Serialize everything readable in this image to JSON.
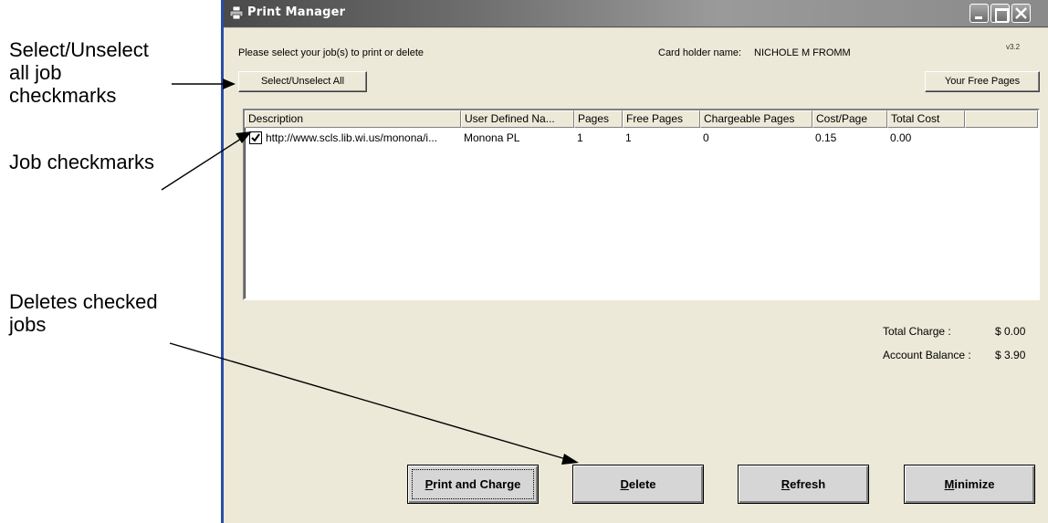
{
  "annotations": {
    "select_all_note": [
      "Select/Unselect",
      "all job",
      "checkmarks"
    ],
    "job_checkmarks_note": "Job checkmarks",
    "delete_note": [
      "Deletes checked",
      "jobs"
    ]
  },
  "window": {
    "title": "Print Manager",
    "version": "v3.2",
    "prompt": "Please select your job(s) to print or delete",
    "card_holder_label": "Card holder name:",
    "card_holder_name": "NICHOLE M FROMM"
  },
  "toolbar": {
    "select_all_label": "Select/Unselect All",
    "free_pages_label": "Your Free Pages"
  },
  "job_list": {
    "columns": [
      "Description",
      "User Defined Na...",
      "Pages",
      "Free Pages",
      "Chargeable Pages",
      "Cost/Page",
      "Total Cost"
    ],
    "rows": [
      {
        "checked": true,
        "description": "http://www.scls.lib.wi.us/monona/i...",
        "user_defined_name": "Monona PL",
        "pages": "1",
        "free_pages": "1",
        "chargeable_pages": "0",
        "cost_per_page": "0.15",
        "total_cost": "0.00"
      }
    ]
  },
  "summary": {
    "total_charge_label": "Total Charge :",
    "total_charge_value": "$ 0.00",
    "account_balance_label": "Account Balance :",
    "account_balance_value": "$ 3.90"
  },
  "actions": {
    "print_first": "P",
    "print_rest": "rint and Charge",
    "delete_first": "D",
    "delete_rest": "elete",
    "refresh_first": "R",
    "refresh_rest": "efresh",
    "minimize_first": "M",
    "minimize_rest": "inimize"
  },
  "icons": {
    "window_icon": "printer-icon",
    "minimize": "minimize-icon",
    "maximize": "maximize-icon",
    "close": "close-icon",
    "checkbox": "checkmark-icon"
  },
  "colors": {
    "titlebar_start": "#4a4a4a",
    "titlebar_end": "#8a8a8a",
    "client_bg": "#ece9d8",
    "button_bg": "#d6d6d6"
  }
}
